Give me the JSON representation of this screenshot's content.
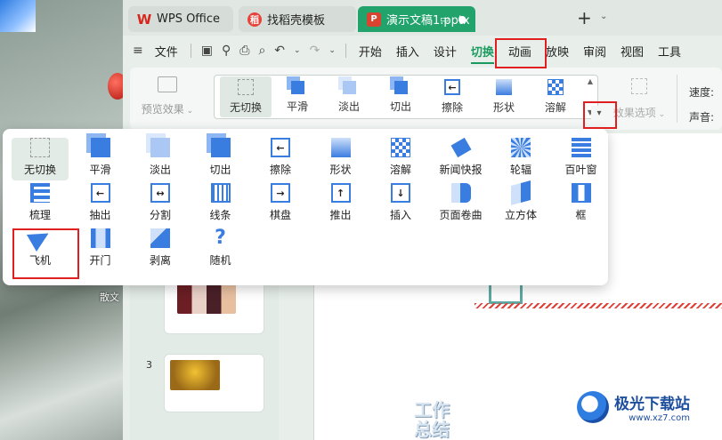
{
  "tabs": [
    {
      "label": "WPS Office",
      "icon": "wps-logo-icon"
    },
    {
      "label": "找稻壳模板",
      "icon": "docer-icon"
    },
    {
      "label": "演示文稿1.pptx",
      "icon": "presentation-file-icon"
    }
  ],
  "menubar": {
    "file": "文件",
    "items": [
      "开始",
      "插入",
      "设计",
      "切换",
      "动画",
      "放映",
      "审阅",
      "视图",
      "工具"
    ],
    "active": "切换"
  },
  "ribbon": {
    "preview_label": "预览效果",
    "gallery": [
      "无切换",
      "平滑",
      "淡出",
      "切出",
      "擦除",
      "形状",
      "溶解"
    ],
    "gallery_selected": "无切换",
    "options_label": "效果选项",
    "speed_label": "速度:",
    "sound_label": "声音:"
  },
  "transitions": [
    {
      "label": "无切换",
      "icon": "none"
    },
    {
      "label": "平滑",
      "icon": "box2"
    },
    {
      "label": "淡出",
      "icon": "light"
    },
    {
      "label": "切出",
      "icon": "box2"
    },
    {
      "label": "擦除",
      "icon": "frame-left"
    },
    {
      "label": "形状",
      "icon": "grad"
    },
    {
      "label": "溶解",
      "icon": "mosaic"
    },
    {
      "label": "新闻快报",
      "icon": "news"
    },
    {
      "label": "轮辐",
      "icon": "wheel"
    },
    {
      "label": "百叶窗",
      "icon": "blind"
    },
    {
      "label": "梳理",
      "icon": "comb"
    },
    {
      "label": "抽出",
      "icon": "frame-left"
    },
    {
      "label": "分割",
      "icon": "frame-split"
    },
    {
      "label": "线条",
      "icon": "lines"
    },
    {
      "label": "棋盘",
      "icon": "frame-right"
    },
    {
      "label": "推出",
      "icon": "frame-up"
    },
    {
      "label": "插入",
      "icon": "frame-down"
    },
    {
      "label": "页面卷曲",
      "icon": "page"
    },
    {
      "label": "立方体",
      "icon": "cube"
    },
    {
      "label": "框",
      "icon": "frame2"
    },
    {
      "label": "飞机",
      "icon": "plane"
    },
    {
      "label": "开门",
      "icon": "door"
    },
    {
      "label": "剥离",
      "icon": "peel"
    },
    {
      "label": "随机",
      "icon": "rand"
    }
  ],
  "selected_transition": "无切换",
  "slides": {
    "slide_3_number": "3"
  },
  "desktop": {
    "label": "散文"
  },
  "canvas_text": {
    "line1": "工作",
    "line2": "总结"
  },
  "watermark": {
    "name": "极光下载站",
    "url": "www.xz7.com"
  },
  "colors": {
    "accent": "#21a36b",
    "icon_blue": "#3a7de0",
    "highlight_red": "#e02020"
  }
}
